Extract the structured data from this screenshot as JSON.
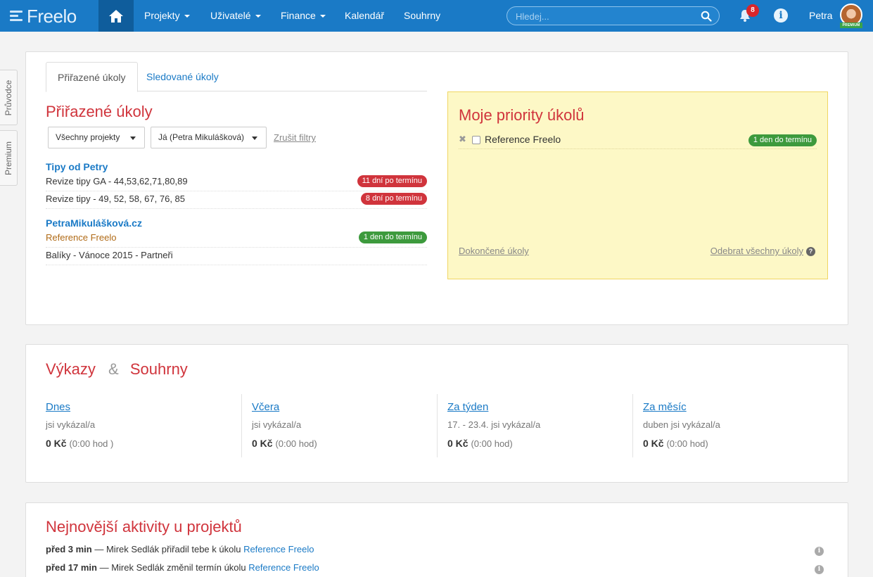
{
  "navbar": {
    "logo_text": "Freelo",
    "items": [
      {
        "label": "Projekty"
      },
      {
        "label": "Uživatelé"
      },
      {
        "label": "Finance"
      },
      {
        "label": "Kalendář"
      },
      {
        "label": "Souhrny"
      }
    ],
    "search_placeholder": "Hledej...",
    "notification_count": "8",
    "user_name": "Petra",
    "premium_label": "PREMIUM"
  },
  "side_tabs": [
    "Průvodce",
    "Premium"
  ],
  "tasks_panel": {
    "tabs": [
      "Přiřazené úkoly",
      "Sledované úkoly"
    ],
    "heading": "Přiřazené úkoly",
    "filter_project": "Všechny projekty",
    "filter_user": "Já (Petra Mikulášková)",
    "clear_filters": "Zrušit filtry",
    "groups": [
      {
        "project": "Tipy od Petry",
        "tasks": [
          {
            "name": "Revize tipy GA - 44,53,62,71,80,89",
            "badge": "11 dní po termínu",
            "badge_color": "#d0343c"
          },
          {
            "name": "Revize tipy - 49, 52, 58, 67, 76, 85",
            "badge": "8 dní po termínu",
            "badge_color": "#d0343c"
          }
        ]
      },
      {
        "project": "PetraMikulášková.cz",
        "tasks": [
          {
            "name": "Reference Freelo",
            "badge": "1 den do termínu",
            "badge_color": "#3d9a3d"
          },
          {
            "name": "Balíky - Vánoce 2015 - Partneři",
            "badge": ""
          }
        ]
      }
    ]
  },
  "priority_panel": {
    "heading": "Moje priority úkolů",
    "item": {
      "name": "Reference Freelo",
      "badge": "1 den do termínu"
    },
    "completed_link": "Dokončené úkoly",
    "remove_all_link": "Odebrat všechny úkoly"
  },
  "reports": {
    "title_left": "Výkazy",
    "ampersand": "&",
    "title_right": "Souhrny",
    "columns": [
      {
        "heading": "Dnes",
        "sub": "jsi vykázal/a",
        "amount": "0 Kč",
        "hours": "(0:00 hod )"
      },
      {
        "heading": "Včera",
        "sub": "jsi vykázal/a",
        "amount": "0 Kč",
        "hours": "(0:00 hod)"
      },
      {
        "heading": "Za týden",
        "sub": "17. - 23.4. jsi vykázal/a",
        "amount": "0 Kč",
        "hours": "(0:00 hod)"
      },
      {
        "heading": "Za měsíc",
        "sub": "duben jsi vykázal/a",
        "amount": "0 Kč",
        "hours": "(0:00 hod)"
      }
    ]
  },
  "activity": {
    "heading": "Nejnovější aktivity u projektů",
    "rows": [
      {
        "time": "před 3 min",
        "text": " — Mirek Sedlák přiřadil tebe k úkolu ",
        "link": "Reference Freelo"
      },
      {
        "time": "před 17 min",
        "text": " — Mirek Sedlák změnil termín úkolu ",
        "link": "Reference Freelo"
      }
    ]
  },
  "colors": {
    "brand": "#1a7ac6",
    "accent_red": "#d0343c",
    "success": "#3d9a3d",
    "priority_bg": "#fdf8c6"
  }
}
